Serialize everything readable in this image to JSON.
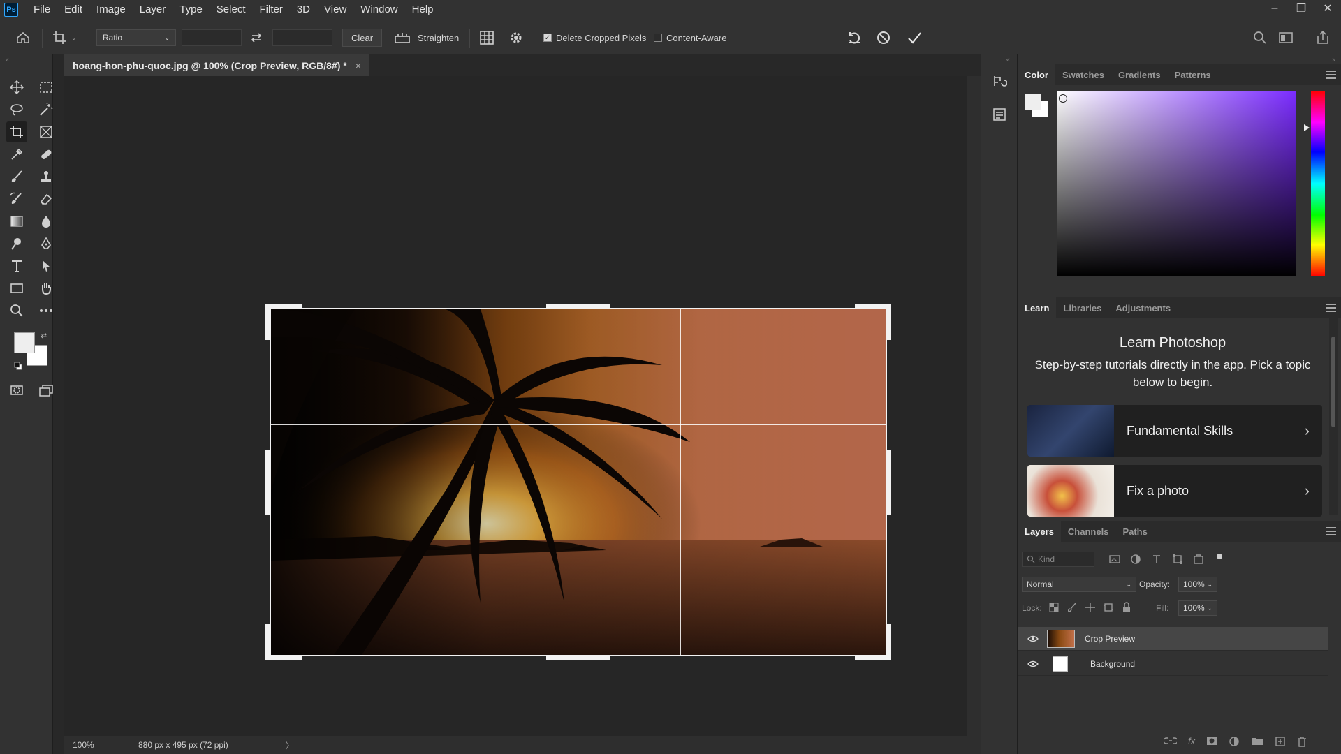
{
  "app": {
    "logo_text": "Ps"
  },
  "menu": [
    "File",
    "Edit",
    "Image",
    "Layer",
    "Type",
    "Select",
    "Filter",
    "3D",
    "View",
    "Window",
    "Help"
  ],
  "window_controls": {
    "minimize": "–",
    "restore": "❐",
    "close": "✕"
  },
  "options": {
    "ratio_label": "Ratio",
    "clear_label": "Clear",
    "straighten_label": "Straighten",
    "delete_cropped_label": "Delete Cropped Pixels",
    "delete_cropped_checked": true,
    "content_aware_label": "Content-Aware",
    "content_aware_checked": false
  },
  "document": {
    "tab_title": "hoang-hon-phu-quoc.jpg @ 100% (Crop Preview, RGB/8#) *",
    "close_glyph": "×"
  },
  "status": {
    "zoom": "100%",
    "size_info": "880 px x 495 px (72 ppi)",
    "arrow": "〉"
  },
  "color_panel": {
    "tabs": [
      "Color",
      "Swatches",
      "Gradients",
      "Patterns"
    ],
    "active_tab": "Color",
    "foreground": "#eeeeee",
    "background": "#ffffff"
  },
  "learn_panel": {
    "tabs": [
      "Learn",
      "Libraries",
      "Adjustments"
    ],
    "active_tab": "Learn",
    "heading": "Learn Photoshop",
    "description": "Step-by-step tutorials directly in the app. Pick a topic below to begin.",
    "cards": [
      {
        "title": "Fundamental Skills",
        "chevron": "›"
      },
      {
        "title": "Fix a photo",
        "chevron": "›"
      }
    ]
  },
  "layers_panel": {
    "tabs": [
      "Layers",
      "Channels",
      "Paths"
    ],
    "active_tab": "Layers",
    "kind_placeholder": "Kind",
    "blend_mode": "Normal",
    "opacity_label": "Opacity:",
    "opacity_value": "100%",
    "lock_label": "Lock:",
    "fill_label": "Fill:",
    "fill_value": "100%",
    "layers": [
      {
        "name": "Crop Preview",
        "selected": true
      },
      {
        "name": "Background",
        "selected": false
      }
    ]
  },
  "colors": {
    "accent": "#31a8ff",
    "ui_dark": "#323232",
    "canvas_bg": "#262626"
  }
}
